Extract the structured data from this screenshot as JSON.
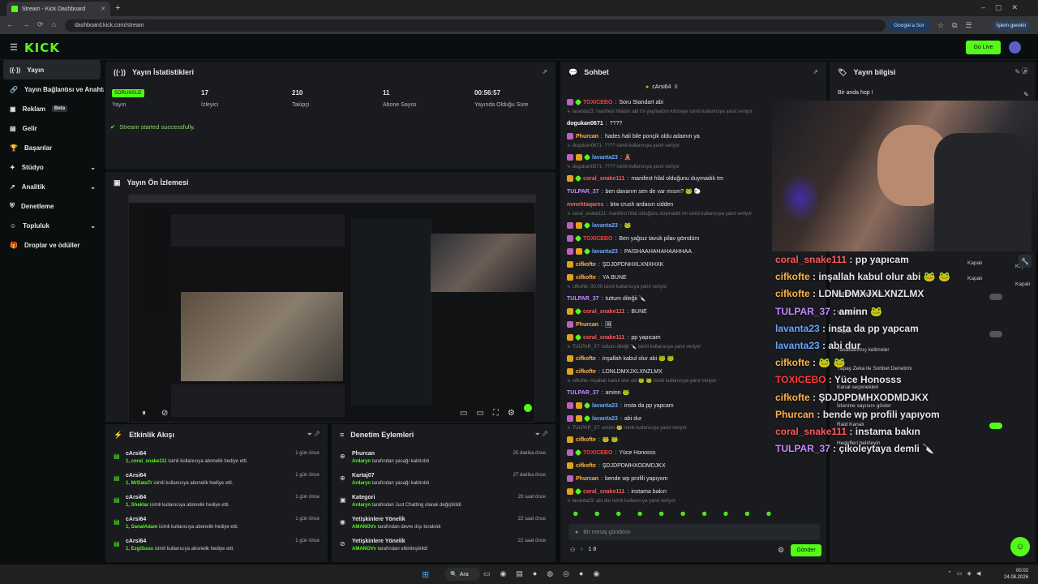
{
  "browser": {
    "tab_title": "Stream - Kick Dashboard",
    "url": "dashboard.kick.com/stream",
    "google_btn": "Google'a Sor",
    "pause_btn": "İşlem gereklı"
  },
  "header": {
    "logo": "KICK",
    "go_live": "Go Live"
  },
  "sidebar": {
    "items": [
      {
        "label": "Yayın",
        "icon": "broadcast-icon"
      },
      {
        "label": "Yayın Bağlantısı ve Anahtar",
        "icon": "link-icon"
      },
      {
        "label": "Reklam",
        "icon": "ad-icon",
        "badge": "Beta"
      },
      {
        "label": "Gelir",
        "icon": "income-icon"
      },
      {
        "label": "Başarılar",
        "icon": "trophy-icon"
      },
      {
        "label": "Stüdyo",
        "icon": "studio-icon"
      },
      {
        "label": "Analitik",
        "icon": "analytics-icon"
      },
      {
        "label": "Denetleme",
        "icon": "shield-icon"
      },
      {
        "label": "Topluluk",
        "icon": "community-icon"
      },
      {
        "label": "Droplar ve ödüller",
        "icon": "gift-icon"
      }
    ]
  },
  "stats": {
    "title": "Yayın İstatistikleri",
    "status_badge": "SORUNSUZ",
    "status_label": "Yayın",
    "viewers_value": "17",
    "viewers_label": "İzleyici",
    "followers_value": "210",
    "followers_label": "Takipçi",
    "subs_value": "11",
    "subs_label": "Abone Sayısı",
    "uptime_value": "00:56:57",
    "uptime_label": "Yayında Olduğu Süre",
    "message": "Stream started successfully."
  },
  "preview": {
    "title": "Yayın Ön İzlemesi"
  },
  "events": {
    "title": "Etkinlik Akışı",
    "rows": [
      {
        "who": "cArsi64",
        "when": "1 gün önce",
        "user": "1, coral_snake111",
        "desc": " isimli kullanıcıya abonelik hediye etti."
      },
      {
        "who": "cArsi64",
        "when": "1 gün önce",
        "user": "1, MrDataTr",
        "desc": " isimli kullanıcıya abonelik hediye etti."
      },
      {
        "who": "cArsi64",
        "when": "1 gün önce",
        "user": "1, Sheklar",
        "desc": " isimli kullanıcıya abonelik hediye etti."
      },
      {
        "who": "cArsi64",
        "when": "1 gün önce",
        "user": "1, SanalAdam",
        "desc": " isimli kullanıcıya abonelik hediye etti."
      },
      {
        "who": "cArsi64",
        "when": "1 gün önce",
        "user": "1, EzgiSuuu",
        "desc": " isimli kullanıcıya abonelik hediye etti."
      }
    ]
  },
  "moderation": {
    "title": "Denetim Eylemleri",
    "rows": [
      {
        "who": "Phurcan",
        "when": "25 dakika önce",
        "actor": "Ardaryn",
        "desc": " tarafından yasağı kaldırıldı",
        "icon": "unban-icon"
      },
      {
        "who": "Kartaj07",
        "when": "27 dakika önce",
        "actor": "Ardaryn",
        "desc": " tarafından yasağı kaldırıldı",
        "icon": "unban-icon"
      },
      {
        "who": "Kategori",
        "when": "20 saat önce",
        "actor": "Ardaryn",
        "desc": " tarafından Just Chatting olarak değiştirildi",
        "icon": "category-icon"
      },
      {
        "who": "Yetişkinlere Yönelik",
        "when": "22 saat önce",
        "actor": "AMANOVv",
        "desc": " tarafından devre dışı bırakıldı",
        "icon": "eye-icon"
      },
      {
        "who": "Yetişkinlere Yönelik",
        "when": "22 saat önce",
        "actor": "AMANOVv",
        "desc": " tarafından etkinleştirildi",
        "icon": "eye-off-icon"
      }
    ]
  },
  "chat": {
    "title": "Sohbet",
    "pinned": "cArsi64",
    "pinned_count": "8",
    "placeholder": "Bir mesaj gönderin",
    "send": "Gönder",
    "viewer_count": "1 8",
    "lines": [
      {
        "type": "msg",
        "badges": [
          "b1",
          "b2"
        ],
        "user": "TOXICEBO",
        "color": "#ff3b3b",
        "text": "Soru Standart abi"
      },
      {
        "type": "reply",
        "text": "↳ lavanta23: manifest hilalsin abi tm yaymadım kimseye isimli kullanıcıya yanıt veriyor"
      },
      {
        "type": "msg",
        "badges": [],
        "user": "dogukan0671",
        "color": "#ffffff",
        "text": "????"
      },
      {
        "type": "msg",
        "badges": [
          "b1"
        ],
        "user": "Phurcan",
        "color": "#ffb347",
        "text": "hades hali bile ponçik oldu adamın ya"
      },
      {
        "type": "reply",
        "text": "↳ dogukan0671: ???? isimli kullanıcıya yanıt veriyor"
      },
      {
        "type": "msg",
        "badges": [
          "b1",
          "b3",
          "b2"
        ],
        "user": "lavanta23",
        "color": "#6aa6ff",
        "text": "🧸"
      },
      {
        "type": "reply",
        "text": "↳ dogukan0671: ???? isimli kullanıcıya yanıt veriyor"
      },
      {
        "type": "msg",
        "badges": [
          "b3",
          "b2"
        ],
        "user": "coral_snake111",
        "color": "#ff5a5a",
        "text": "manifest hilal olduğunu duymadık tm"
      },
      {
        "type": "msg",
        "badges": [],
        "user": "TULPAR_37",
        "color": "#c48bff",
        "text": "ben davarım sen de var mısın? 🐸 🐑"
      },
      {
        "type": "msg",
        "badges": [],
        "user": "mmehtaqares",
        "color": "#ff6060",
        "text": "btw crush ardasın cidden"
      },
      {
        "type": "reply",
        "text": "↳ coral_snake111: manifest hilal olduğunu duymadık tm isimli kullanıcıya yanıt veriyor"
      },
      {
        "type": "msg",
        "badges": [
          "b1",
          "b3",
          "b2"
        ],
        "user": "lavanta23",
        "color": "#6aa6ff",
        "text": "🐸"
      },
      {
        "type": "msg",
        "badges": [
          "b1",
          "b2"
        ],
        "user": "TOXICEBO",
        "color": "#ff3b3b",
        "text": "Ben yağsız tavuk pilav gömdüm"
      },
      {
        "type": "msg",
        "badges": [
          "b1",
          "b3",
          "b2"
        ],
        "user": "lavanta23",
        "color": "#6aa6ff",
        "text": "PAİSHAAHAHAHAAHHAA"
      },
      {
        "type": "msg",
        "badges": [
          "b3"
        ],
        "user": "cifkofte",
        "color": "#ffb347",
        "text": "ŞDJDPDNHXLXNXHXK"
      },
      {
        "type": "msg",
        "badges": [
          "b3"
        ],
        "user": "cifkofte",
        "color": "#ffb347",
        "text": "YA BUNE"
      },
      {
        "type": "reply",
        "text": "↳ cifkofte: 00.00 isimli kullanıcıya yanıt veriyor"
      },
      {
        "type": "msg",
        "badges": [],
        "user": "TULPAR_37",
        "color": "#c48bff",
        "text": "tuttum dileğii 🔪"
      },
      {
        "type": "msg",
        "badges": [
          "b3",
          "b2"
        ],
        "user": "coral_snake111",
        "color": "#ff5a5a",
        "text": "BUNE"
      },
      {
        "type": "msg",
        "badges": [
          "b1"
        ],
        "user": "Phurcan",
        "color": "#ffb347",
        "text": "🖼"
      },
      {
        "type": "msg",
        "badges": [
          "b3",
          "b2"
        ],
        "user": "coral_snake111",
        "color": "#ff5a5a",
        "text": "pp yapıcam"
      },
      {
        "type": "reply",
        "text": "↳ TULPAR_37: tuttum dileğii 🔪 isimli kullanıcıya yanıt veriyor"
      },
      {
        "type": "msg",
        "badges": [
          "b3"
        ],
        "user": "cifkofte",
        "color": "#ffb347",
        "text": "inşallah kabul olur abi 🐸 🐸"
      },
      {
        "type": "msg",
        "badges": [
          "b3"
        ],
        "user": "cifkofte",
        "color": "#ffb347",
        "text": "LDNLDMXJXLXNZLMX"
      },
      {
        "type": "reply",
        "text": "↳ cifkofte: inşallah kabul olur abi 🐸 🐸 isimli kullanıcıya yanıt veriyor"
      },
      {
        "type": "msg",
        "badges": [],
        "user": "TULPAR_37",
        "color": "#c48bff",
        "text": "aminn 🐸"
      },
      {
        "type": "msg",
        "badges": [
          "b1",
          "b3",
          "b2"
        ],
        "user": "lavanta23",
        "color": "#6aa6ff",
        "text": "insta da pp yapcam"
      },
      {
        "type": "msg",
        "badges": [
          "b1",
          "b3",
          "b2"
        ],
        "user": "lavanta23",
        "color": "#6aa6ff",
        "text": "abi dur"
      },
      {
        "type": "reply",
        "text": "↳ TULPAR_37: aminn 🐸 isimli kullanıcıya yanıt veriyor"
      },
      {
        "type": "msg",
        "badges": [
          "b3"
        ],
        "user": "cifkofte",
        "color": "#ffb347",
        "text": "🐸 🐸"
      },
      {
        "type": "msg",
        "badges": [
          "b1",
          "b2"
        ],
        "user": "TOXICEBO",
        "color": "#ff3b3b",
        "text": "Yüce Honosss"
      },
      {
        "type": "msg",
        "badges": [
          "b3"
        ],
        "user": "cifkofte",
        "color": "#ffb347",
        "text": "ŞDJDPDMHXODMDJKX"
      },
      {
        "type": "msg",
        "badges": [
          "b1"
        ],
        "user": "Phurcan",
        "color": "#ffb347",
        "text": "bende wp profili yapıyom"
      },
      {
        "type": "msg",
        "badges": [
          "b3",
          "b2"
        ],
        "user": "coral_snake111",
        "color": "#ff5a5a",
        "text": "instama bakın"
      },
      {
        "type": "reply",
        "text": "↳ lavanta23: abi dur isimli kullanıcıya yanıt veriyor"
      },
      {
        "type": "msg",
        "badges": [],
        "user": "TULPAR_37",
        "color": "#c48bff",
        "text": "çikoleytaya demli 🔪"
      }
    ]
  },
  "streaminfo": {
    "title": "Yayın bilgisi",
    "text": "Bir anda hop !",
    "settings": [
      {
        "label": "Kapalı"
      },
      {
        "label": "Kapalı"
      }
    ]
  },
  "overlay": {
    "lines": [
      {
        "user": "coral_snake111",
        "color": "#ff5a5a",
        "text": "pp yapıcam"
      },
      {
        "user": "cifkofte",
        "color": "#ffb347",
        "text": "inşallah kabul olur abi 🐸 🐸"
      },
      {
        "user": "cifkofte",
        "color": "#ffb347",
        "text": "LDNLDMXJXLXNZLMX"
      },
      {
        "user": "TULPAR_37",
        "color": "#c48bff",
        "text": "aminn 🐸"
      },
      {
        "user": "lavanta23",
        "color": "#6aa6ff",
        "text": "insta da pp yapcam"
      },
      {
        "user": "lavanta23",
        "color": "#6aa6ff",
        "text": "abi dur"
      },
      {
        "user": "cifkofte",
        "color": "#ffb347",
        "text": "🐸 🐸"
      },
      {
        "user": "TOXICEBO",
        "color": "#ff3b3b",
        "text": "Yüce Honosss"
      },
      {
        "user": "cifkofte",
        "color": "#ffb347",
        "text": "ŞDJDPDMHXODMDJKX"
      },
      {
        "user": "Phurcan",
        "color": "#ffb347",
        "text": "bende wp profili yapıyom"
      },
      {
        "user": "coral_snake111",
        "color": "#ff5a5a",
        "text": "instama bakın"
      },
      {
        "user": "TULPAR_37",
        "color": "#c48bff",
        "text": "çikoleytaya demli 🔪"
      }
    ],
    "under": [
      "Kapalı",
      "Kapalı",
      "Sohbet seçenekleri",
      "Yavaş mod",
      "Kapalı",
      "Yasaklanmış kelimeler",
      "Yapay Zeka ile Sohbet Denetimi",
      "Kanal seçenekleri",
      "İzlenme sayısını göster",
      "Raid Kanalı",
      "Hedefleri belirleyin"
    ]
  },
  "taskbar": {
    "search": "Ara",
    "time": "00:02",
    "date": "24.08.2026"
  },
  "colors": {
    "accent": "#53fc18",
    "panel": "#191b1f",
    "bg": "#0b0e0f"
  }
}
